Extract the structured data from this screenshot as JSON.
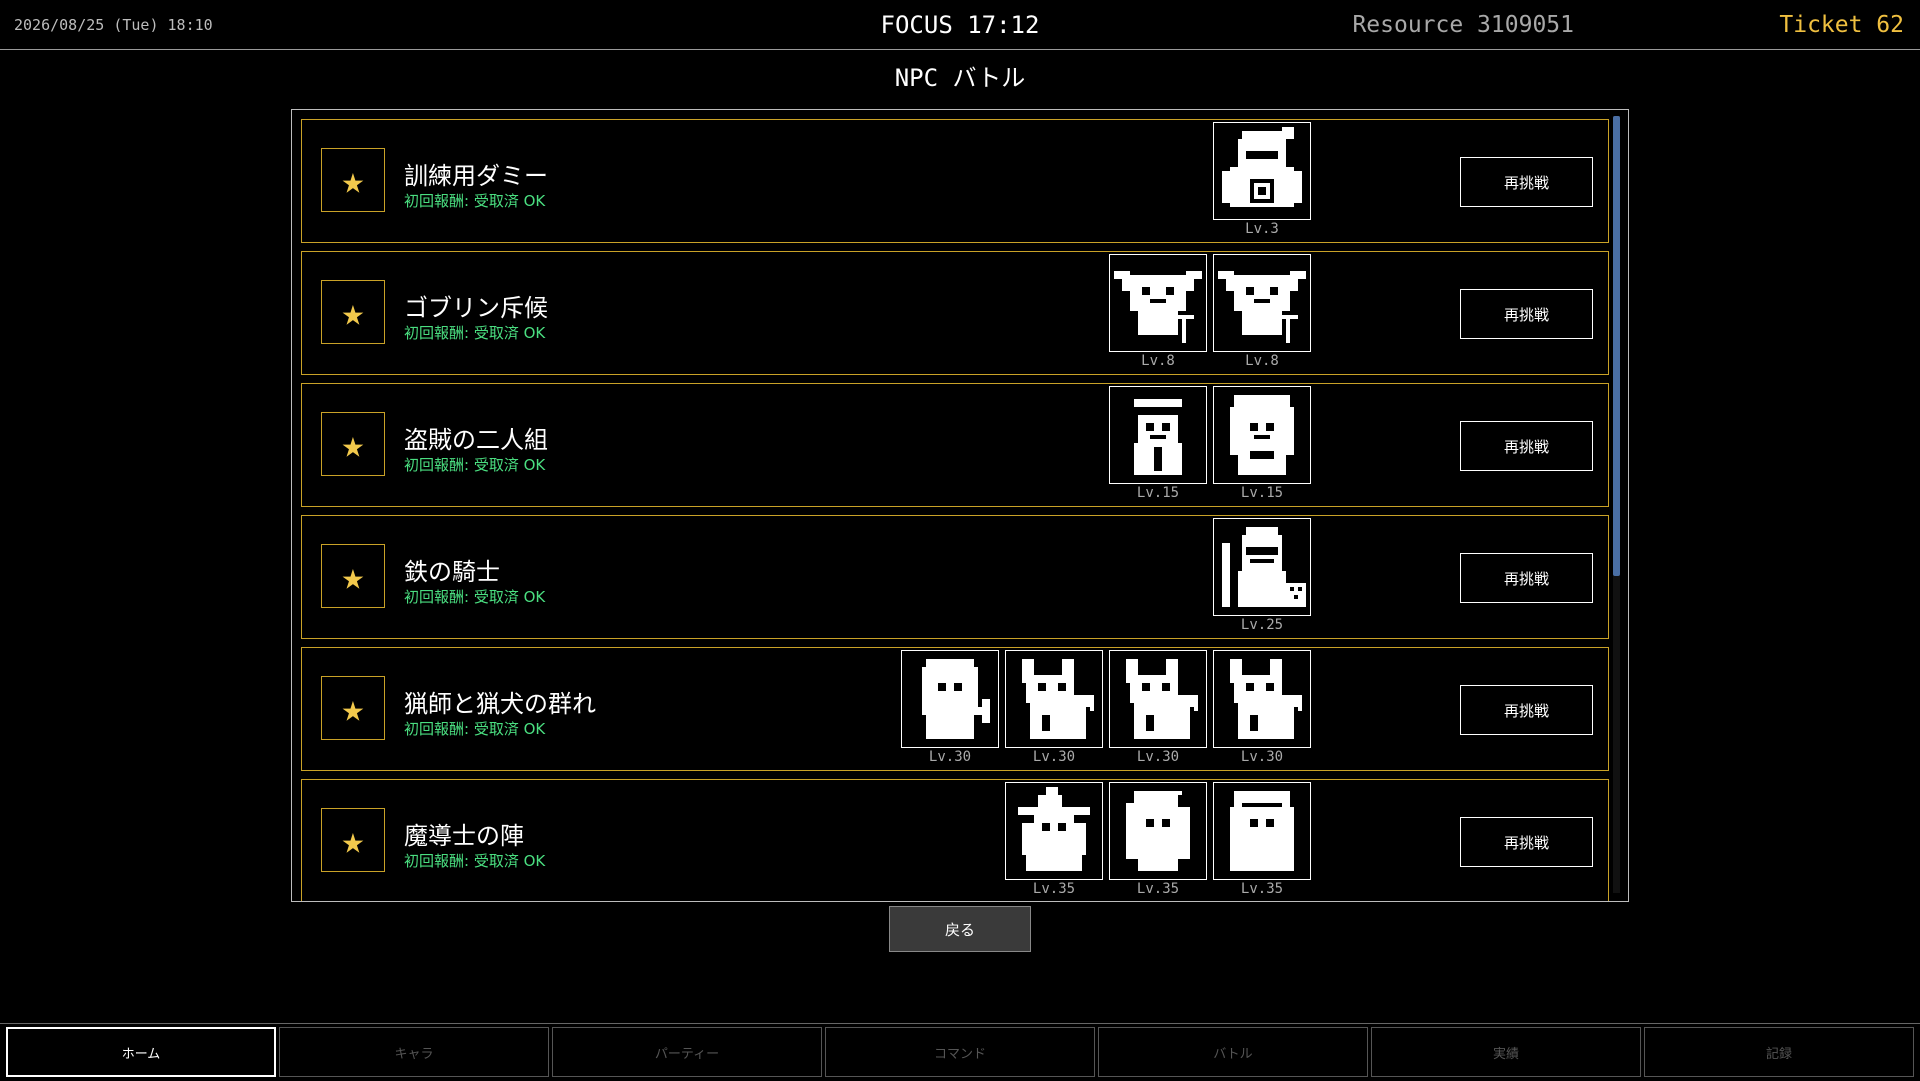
{
  "header": {
    "datetime": "2026/08/25 (Tue) 18:10",
    "focus": "FOCUS 17:12",
    "resource": "Resource 3109051",
    "ticket": "Ticket 62"
  },
  "page": {
    "title": "NPC バトル"
  },
  "rows": [
    {
      "title": "訓練用ダミー",
      "status": "初回報酬: 受取済 OK",
      "button": "再挑戦",
      "enemies": [
        {
          "icon": "dummy-icon",
          "lv": "Lv.3"
        }
      ]
    },
    {
      "title": "ゴブリン斥候",
      "status": "初回報酬: 受取済 OK",
      "button": "再挑戦",
      "enemies": [
        {
          "icon": "goblin-icon",
          "lv": "Lv.8"
        },
        {
          "icon": "goblin-icon",
          "lv": "Lv.8"
        }
      ]
    },
    {
      "title": "盗賊の二人組",
      "status": "初回報酬: 受取済 OK",
      "button": "再挑戦",
      "enemies": [
        {
          "icon": "bandit-icon",
          "lv": "Lv.15"
        },
        {
          "icon": "hooded-bandit-icon",
          "lv": "Lv.15"
        }
      ]
    },
    {
      "title": "鉄の騎士",
      "status": "初回報酬: 受取済 OK",
      "button": "再挑戦",
      "enemies": [
        {
          "icon": "knight-icon",
          "lv": "Lv.25"
        }
      ]
    },
    {
      "title": "猟師と猟犬の群れ",
      "status": "初回報酬: 受取済 OK",
      "button": "再挑戦",
      "enemies": [
        {
          "icon": "hunter-icon",
          "lv": "Lv.30"
        },
        {
          "icon": "hound-icon",
          "lv": "Lv.30"
        },
        {
          "icon": "hound-icon",
          "lv": "Lv.30"
        },
        {
          "icon": "hound-icon",
          "lv": "Lv.30"
        }
      ]
    },
    {
      "title": "魔導士の陣",
      "status": "初回報酬: 受取済 OK",
      "button": "再挑戦",
      "enemies": [
        {
          "icon": "witch-icon",
          "lv": "Lv.35"
        },
        {
          "icon": "mage-icon",
          "lv": "Lv.35"
        },
        {
          "icon": "nun-mage-icon",
          "lv": "Lv.35"
        }
      ]
    }
  ],
  "back_button": "戻る",
  "nav": {
    "tabs": [
      "ホーム",
      "キャラ",
      "パーティー",
      "コマンド",
      "バトル",
      "実績",
      "記録"
    ],
    "active": 0
  },
  "colors": {
    "accent_gold": "#c9a227",
    "star": "#f2c94c",
    "status_green": "#4ade80",
    "ticket": "#f0c040",
    "scrollbar": "#4a6fa5"
  }
}
